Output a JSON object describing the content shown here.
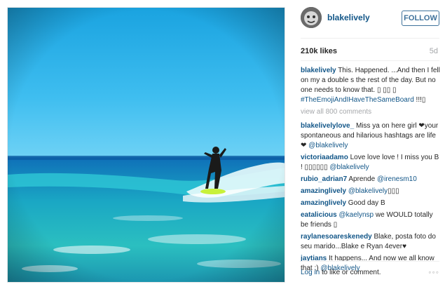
{
  "post": {
    "username": "blakelively",
    "follow_label": "FOLLOW",
    "likes": "210k likes",
    "time_ago": "5d",
    "caption": {
      "username": "blakelively",
      "text": " This. Happened. ...And then I fell on my a double s the rest of the day. But no one needs to know that. ▯ ▯▯ ▯",
      "hashtag": "#TheEmojiAndIHaveTheSameBoard",
      "tail": " !!!▯"
    },
    "view_all": "view all 800 comments"
  },
  "comments": [
    {
      "username": "blakelivelylove_",
      "text": " Miss ya on here girl ❤your spontaneous and hilarious hashtags are life ❤ ",
      "mention": "@blakelively",
      "tail": ""
    },
    {
      "username": "victoriaadamo",
      "text": " Love love love ! I miss you B ! ▯▯▯▯▯▯ ",
      "mention": "@blakelively",
      "tail": ""
    },
    {
      "username": "rubio_adrian7",
      "text": " Aprende ",
      "mention": "@irenesm10",
      "tail": ""
    },
    {
      "username": "amazinglively",
      "text": " ",
      "mention": "@blakelively",
      "tail": "▯▯▯"
    },
    {
      "username": "amazinglively",
      "text": " Good day B",
      "mention": "",
      "tail": ""
    },
    {
      "username": "eatalicious",
      "text": " ",
      "mention": "@kaelynsp",
      "tail": " we WOULD totally be friends ▯"
    },
    {
      "username": "raylanesoareskenedy",
      "text": " Blake, posta foto do seu marido...Blake e Ryan 4ever♥",
      "mention": "",
      "tail": ""
    },
    {
      "username": "jaytians",
      "text": " It happens... And now we all know that ;) ",
      "mention": "@blakelively",
      "tail": ""
    }
  ],
  "footer": {
    "login_label": "Log in",
    "rest": " to like or comment.",
    "more_icon": "more-dots-icon",
    "more_glyph": "◦◦◦"
  },
  "colors": {
    "link": "#125688",
    "follow": "#3f729b",
    "muted": "#a5a7aa",
    "text": "#262626"
  }
}
